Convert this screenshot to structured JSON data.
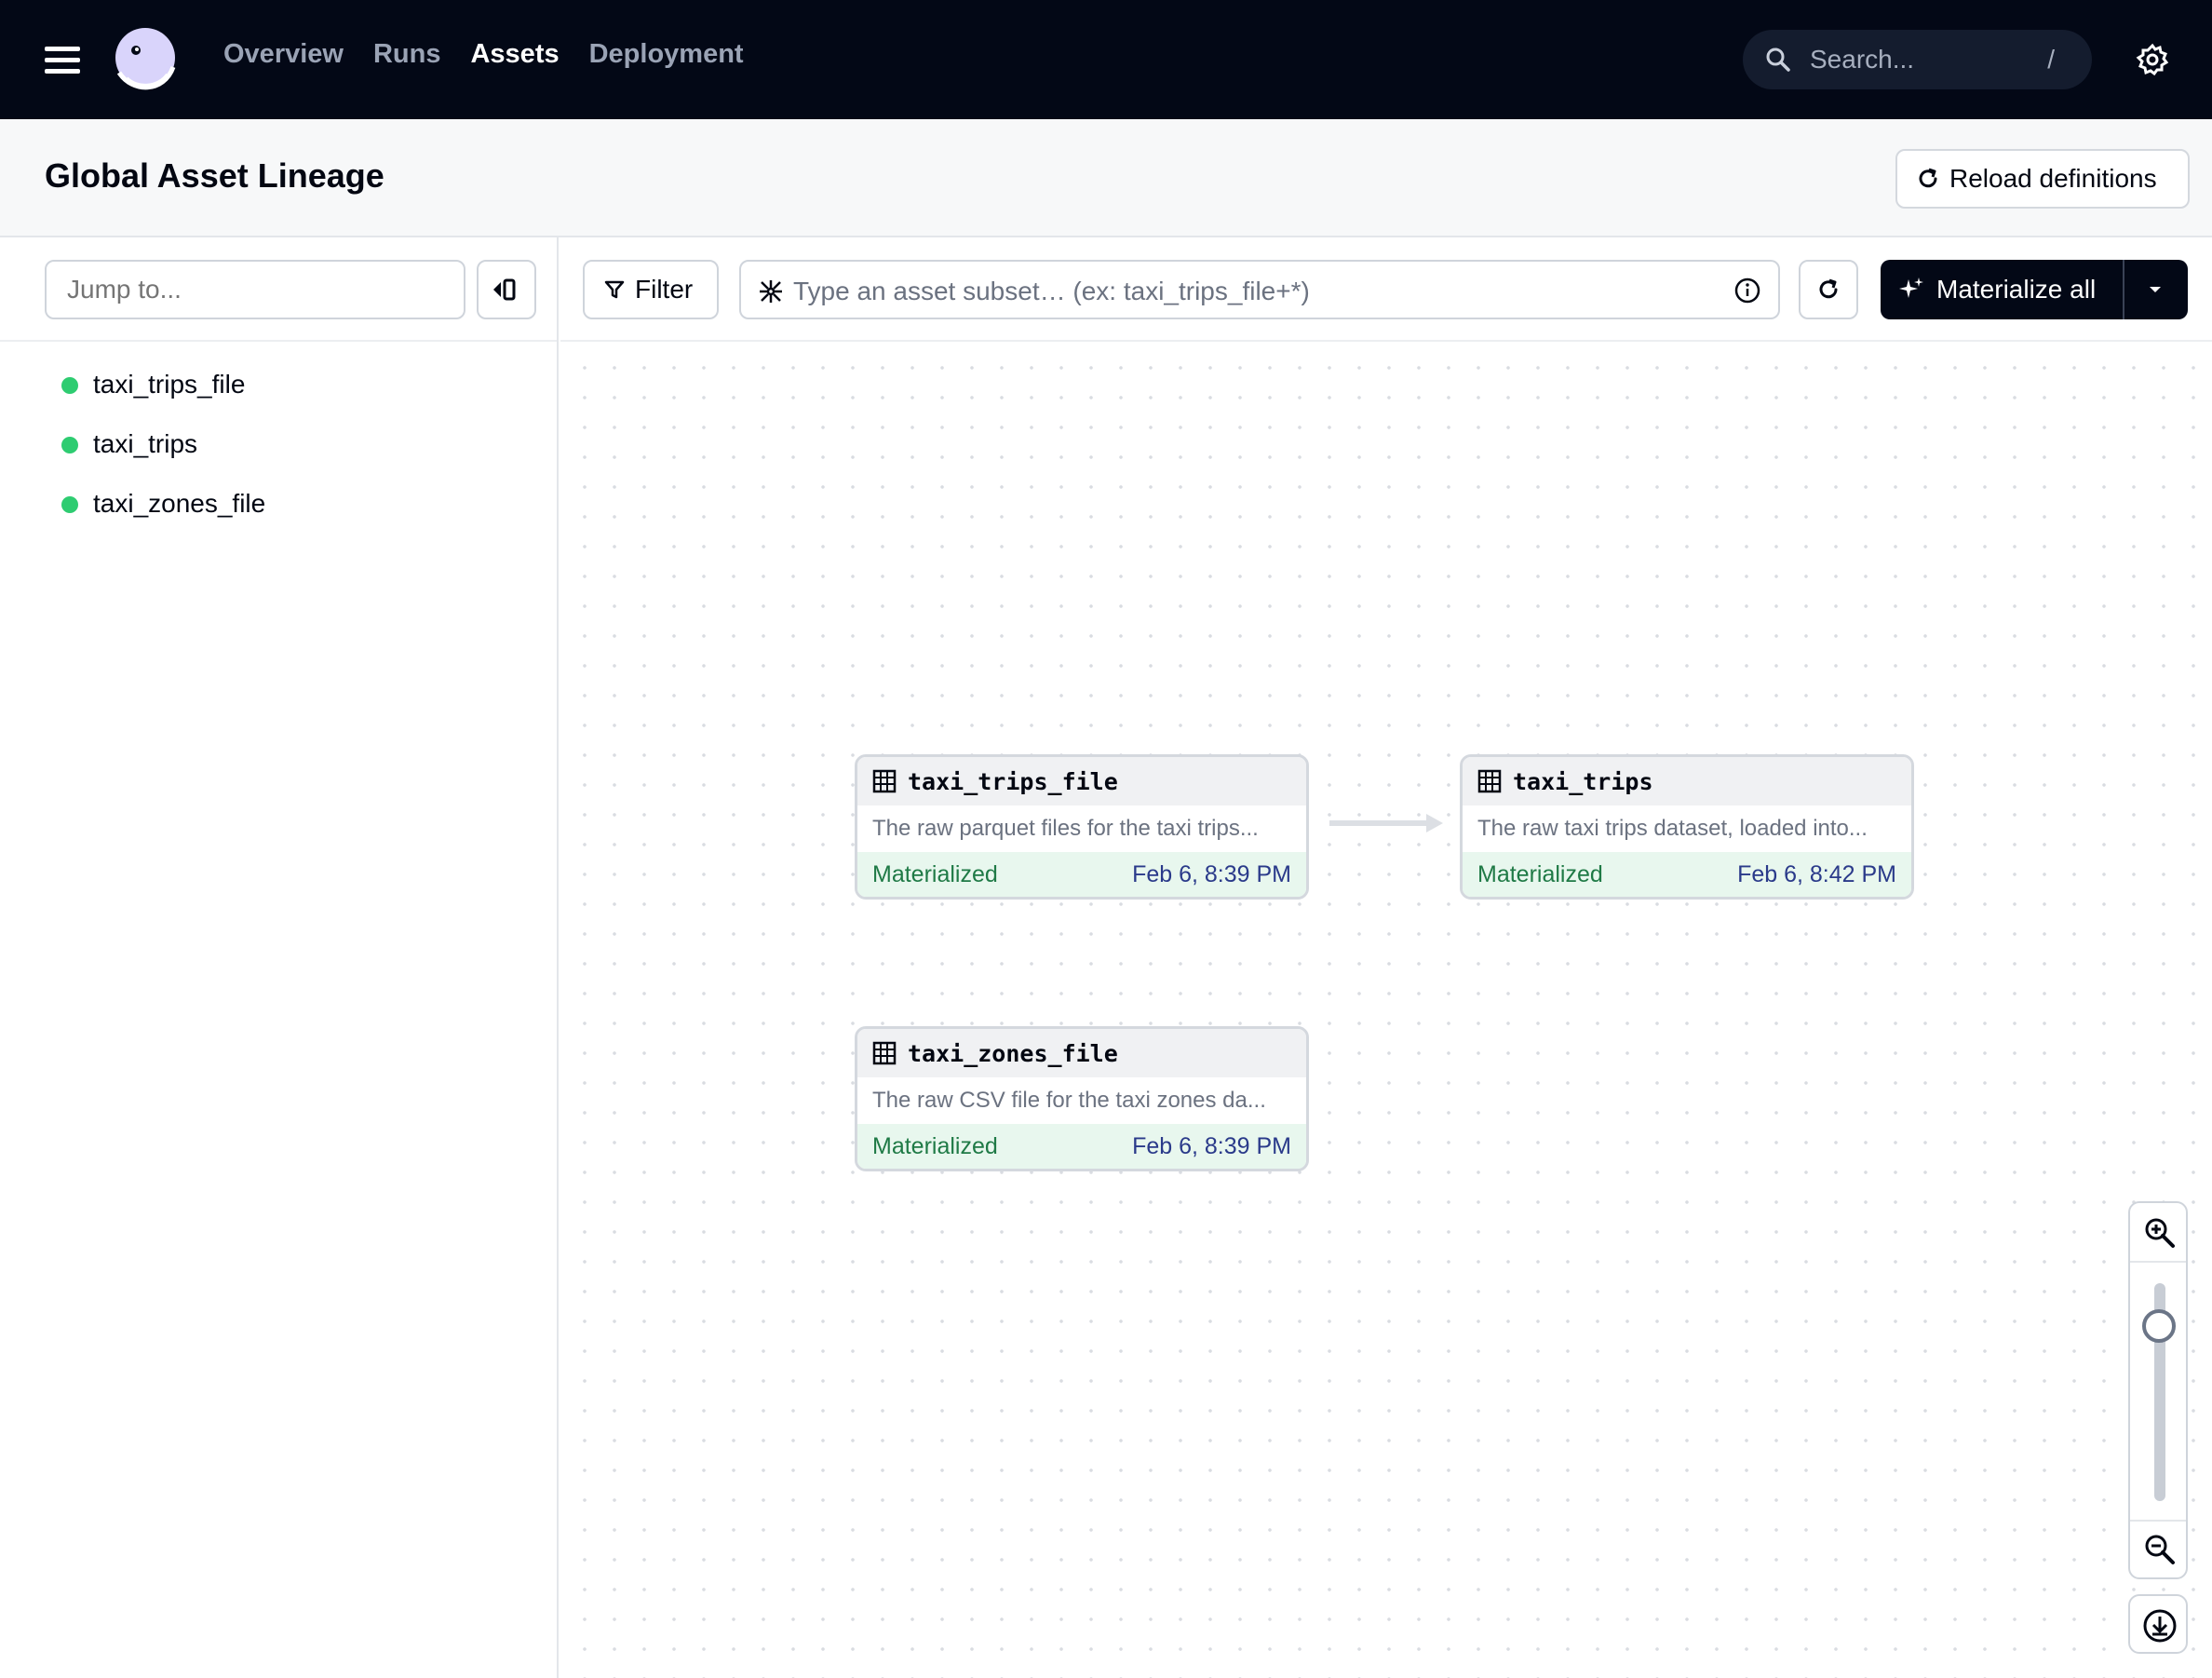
{
  "nav": {
    "links": [
      {
        "label": "Overview",
        "active": false
      },
      {
        "label": "Runs",
        "active": false
      },
      {
        "label": "Assets",
        "active": true
      },
      {
        "label": "Deployment",
        "active": false
      }
    ],
    "search_placeholder": "Search...",
    "search_shortcut": "/"
  },
  "header": {
    "title": "Global Asset Lineage",
    "reload_label": "Reload definitions"
  },
  "sidebar": {
    "jump_placeholder": "Jump to...",
    "assets": [
      {
        "name": "taxi_trips_file",
        "status_color": "#2ecc71"
      },
      {
        "name": "taxi_trips",
        "status_color": "#2ecc71"
      },
      {
        "name": "taxi_zones_file",
        "status_color": "#2ecc71"
      }
    ]
  },
  "toolbar": {
    "filter_label": "Filter",
    "subset_placeholder": "Type an asset subset… (ex: taxi_trips_file+*)",
    "materialize_label": "Materialize all"
  },
  "graph": {
    "nodes": [
      {
        "name": "taxi_trips_file",
        "description": "The raw parquet files for the taxi trips...",
        "status": "Materialized",
        "timestamp": "Feb 6, 8:39 PM"
      },
      {
        "name": "taxi_trips",
        "description": "The raw taxi trips dataset, loaded into...",
        "status": "Materialized",
        "timestamp": "Feb 6, 8:42 PM"
      },
      {
        "name": "taxi_zones_file",
        "description": "The raw CSV file for the taxi zones da...",
        "status": "Materialized",
        "timestamp": "Feb 6, 8:39 PM"
      }
    ]
  },
  "colors": {
    "nav_bg": "#030816",
    "status_green": "#2ecc71",
    "materialized_text": "#1f7a46",
    "timestamp_text": "#2a3a8a"
  }
}
